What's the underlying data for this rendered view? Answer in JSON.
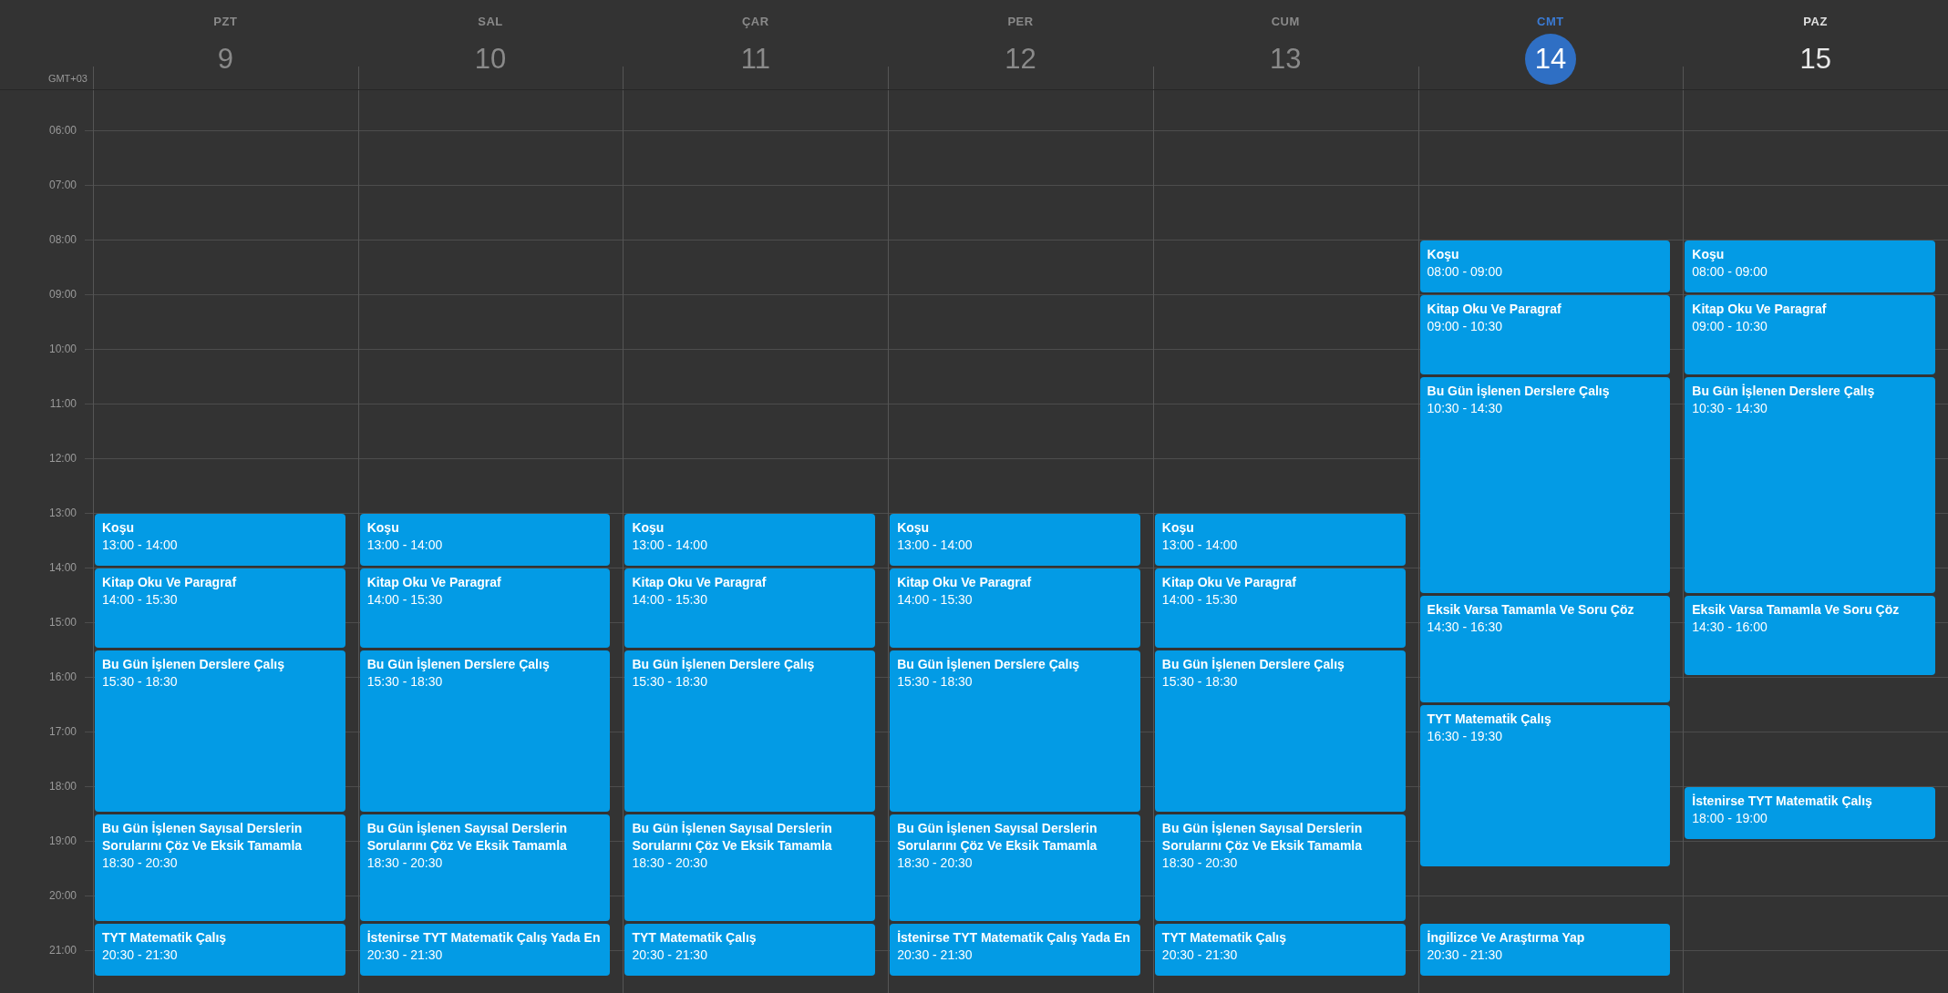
{
  "timezone": "GMT+03",
  "hours": [
    "06:00",
    "07:00",
    "08:00",
    "09:00",
    "10:00",
    "11:00",
    "12:00",
    "13:00",
    "14:00",
    "15:00",
    "16:00",
    "17:00",
    "18:00",
    "19:00",
    "20:00",
    "21:00"
  ],
  "days": [
    {
      "label": "PZT",
      "number": "9",
      "kind": "past",
      "events": [
        {
          "title": "Koşu",
          "time": "13:00 - 14:00"
        },
        {
          "title": "Kitap Oku Ve Paragraf",
          "time": "14:00 - 15:30"
        },
        {
          "title": "Bu Gün İşlenen Derslere Çalış",
          "time": "15:30 - 18:30"
        },
        {
          "title": "Bu Gün İşlenen Sayısal Derslerin Sorularını Çöz Ve Eksik Tamamla",
          "time": "18:30 - 20:30"
        },
        {
          "title": "TYT Matematik Çalış",
          "time": "20:30 - 21:30"
        }
      ]
    },
    {
      "label": "SAL",
      "number": "10",
      "kind": "past",
      "events": [
        {
          "title": "Koşu",
          "time": "13:00 - 14:00"
        },
        {
          "title": "Kitap Oku Ve Paragraf",
          "time": "14:00 - 15:30"
        },
        {
          "title": "Bu Gün İşlenen Derslere Çalış",
          "time": "15:30 - 18:30"
        },
        {
          "title": "Bu Gün İşlenen Sayısal Derslerin Sorularını Çöz Ve Eksik Tamamla",
          "time": "18:30 - 20:30"
        },
        {
          "title": "İstenirse TYT Matematik Çalış Yada En",
          "time": "20:30 - 21:30"
        }
      ]
    },
    {
      "label": "ÇAR",
      "number": "11",
      "kind": "past",
      "events": [
        {
          "title": "Koşu",
          "time": "13:00 - 14:00"
        },
        {
          "title": "Kitap Oku Ve Paragraf",
          "time": "14:00 - 15:30"
        },
        {
          "title": "Bu Gün İşlenen Derslere Çalış",
          "time": "15:30 - 18:30"
        },
        {
          "title": "Bu Gün İşlenen Sayısal Derslerin Sorularını Çöz Ve Eksik Tamamla",
          "time": "18:30 - 20:30"
        },
        {
          "title": "TYT Matematik Çalış",
          "time": "20:30 - 21:30"
        }
      ]
    },
    {
      "label": "PER",
      "number": "12",
      "kind": "past",
      "events": [
        {
          "title": "Koşu",
          "time": "13:00 - 14:00"
        },
        {
          "title": "Kitap Oku Ve Paragraf",
          "time": "14:00 - 15:30"
        },
        {
          "title": "Bu Gün İşlenen Derslere Çalış",
          "time": "15:30 - 18:30"
        },
        {
          "title": "Bu Gün İşlenen Sayısal Derslerin Sorularını Çöz Ve Eksik Tamamla",
          "time": "18:30 - 20:30"
        },
        {
          "title": "İstenirse TYT Matematik Çalış Yada En",
          "time": "20:30 - 21:30"
        }
      ]
    },
    {
      "label": "CUM",
      "number": "13",
      "kind": "past",
      "events": [
        {
          "title": "Koşu",
          "time": "13:00 - 14:00"
        },
        {
          "title": "Kitap Oku Ve Paragraf",
          "time": "14:00 - 15:30"
        },
        {
          "title": "Bu Gün İşlenen Derslere Çalış",
          "time": "15:30 - 18:30"
        },
        {
          "title": "Bu Gün İşlenen Sayısal Derslerin Sorularını Çöz Ve Eksik Tamamla",
          "time": "18:30 - 20:30"
        },
        {
          "title": "TYT Matematik Çalış",
          "time": "20:30 - 21:30"
        }
      ]
    },
    {
      "label": "CMT",
      "number": "14",
      "kind": "today",
      "events": [
        {
          "title": "Koşu",
          "time": "08:00 - 09:00"
        },
        {
          "title": "Kitap Oku Ve Paragraf",
          "time": "09:00 - 10:30"
        },
        {
          "title": "Bu Gün İşlenen Derslere Çalış",
          "time": "10:30 - 14:30"
        },
        {
          "title": "Eksik Varsa Tamamla Ve Soru Çöz",
          "time": "14:30 - 16:30"
        },
        {
          "title": "TYT Matematik Çalış",
          "time": "16:30 - 19:30"
        },
        {
          "title": "İngilizce Ve Araştırma Yap",
          "time": "20:30 - 21:30"
        }
      ]
    },
    {
      "label": "PAZ",
      "number": "15",
      "kind": "upcoming",
      "events": [
        {
          "title": "Koşu",
          "time": "08:00 - 09:00"
        },
        {
          "title": "Kitap Oku Ve Paragraf",
          "time": "09:00 - 10:30"
        },
        {
          "title": "Bu Gün İşlenen Derslere Çalış",
          "time": "10:30 - 14:30"
        },
        {
          "title": "Eksik Varsa Tamamla Ve Soru Çöz",
          "time": "14:30 - 16:00"
        },
        {
          "title": "İstenirse TYT Matematik Çalış",
          "time": "18:00 - 19:00"
        }
      ]
    }
  ]
}
